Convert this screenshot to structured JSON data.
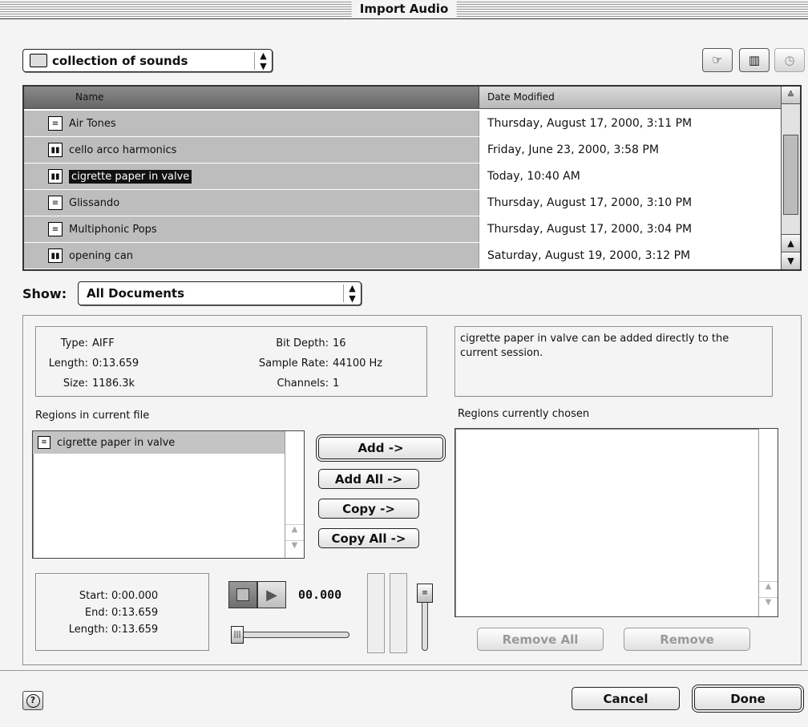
{
  "window": {
    "title": "Import Audio"
  },
  "location": {
    "folder": "collection of sounds"
  },
  "toolbar": {
    "shortcuts": "shortcuts-icon",
    "favorites": "favorites-icon",
    "recent": "recent-icon"
  },
  "file_list": {
    "columns": [
      "Name",
      "Date Modified"
    ],
    "rows": [
      {
        "name": "Air Tones",
        "date": "Thursday, August 17, 2000, 3:11 PM",
        "icon": "document-icon"
      },
      {
        "name": "cello arco harmonics",
        "date": "Friday, June 23, 2000, 3:58 PM",
        "icon": "audio-file-icon"
      },
      {
        "name": "cigrette paper in valve",
        "date": "Today, 10:40 AM",
        "icon": "audio-file-icon",
        "selected": true
      },
      {
        "name": "Glissando",
        "date": "Thursday, August 17, 2000, 3:10 PM",
        "icon": "document-icon"
      },
      {
        "name": "Multiphonic Pops",
        "date": "Thursday, August 17, 2000, 3:04 PM",
        "icon": "document-icon"
      },
      {
        "name": "opening can",
        "date": "Saturday, August 19, 2000, 3:12 PM",
        "icon": "audio-file-icon"
      }
    ]
  },
  "show": {
    "label": "Show:",
    "value": "All Documents"
  },
  "file_info": {
    "type_label": "Type:",
    "type": "AIFF",
    "length_label": "Length:",
    "length": "0:13.659",
    "size_label": "Size:",
    "size": "1186.3k",
    "bitdepth_label": "Bit Depth:",
    "bitdepth": "16",
    "samplerate_label": "Sample Rate:",
    "samplerate": "44100 Hz",
    "channels_label": "Channels:",
    "channels": "1"
  },
  "message": "cigrette paper in valve can be added directly to the current session.",
  "regions_current": {
    "label": "Regions in current file",
    "items": [
      "cigrette paper in valve"
    ]
  },
  "regions_chosen": {
    "label": "Regions currently chosen",
    "items": []
  },
  "buttons": {
    "add": "Add ->",
    "add_all": "Add All ->",
    "copy": "Copy ->",
    "copy_all": "Copy All ->",
    "remove_all": "Remove All",
    "remove": "Remove",
    "cancel": "Cancel",
    "done": "Done",
    "help": "?"
  },
  "selection_info": {
    "start_label": "Start:",
    "start": "0:00.000",
    "end_label": "End:",
    "end": "0:13.659",
    "length_label": "Length:",
    "length": "0:13.659"
  },
  "playback": {
    "counter": "00.000",
    "position_fraction": 0.0,
    "volume_fraction": 1.0
  }
}
